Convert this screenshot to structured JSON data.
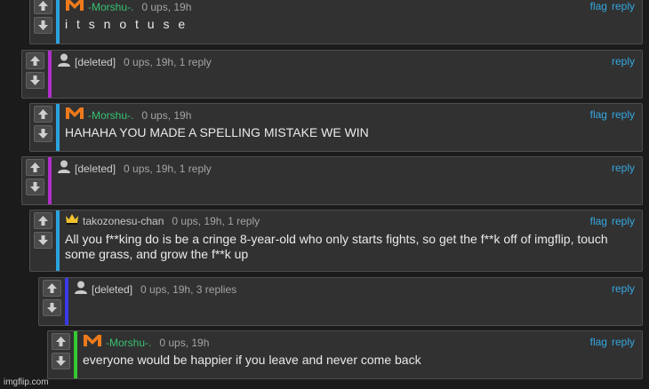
{
  "comments": [
    {
      "user": "-Morshu-.",
      "meta": "0 ups, 19h",
      "flag": "flag",
      "reply": "reply",
      "text": "i t s n o t u s e"
    },
    {
      "user": "[deleted]",
      "meta": "0 ups, 19h, 1 reply",
      "reply": "reply",
      "text": ""
    },
    {
      "user": "-Morshu-.",
      "meta": "0 ups, 19h",
      "flag": "flag",
      "reply": "reply",
      "text": "HAHAHA YOU MADE A SPELLING MISTAKE WE WIN"
    },
    {
      "user": "[deleted]",
      "meta": "0 ups, 19h, 1 reply",
      "reply": "reply",
      "text": ""
    },
    {
      "user": "takozonesu-chan",
      "meta": "0 ups, 19h, 1 reply",
      "flag": "flag",
      "reply": "reply",
      "text": "All you f**king do is be a cringe 8-year-old who only starts fights, so get the f**k off of imgflip, touch some grass, and grow the f**k up"
    },
    {
      "user": "[deleted]",
      "meta": "0 ups, 19h, 3 replies",
      "reply": "reply",
      "text": ""
    },
    {
      "user": "-Morshu-.",
      "meta": "0 ups, 19h",
      "flag": "flag",
      "reply": "reply",
      "text": "everyone would be happier if you leave and never come back"
    }
  ],
  "colors": {
    "panel": "#313131",
    "bar_cyan": "#2aa4de",
    "bar_magenta": "#b12fc9",
    "bar_blue": "#3a3ae6",
    "bar_green": "#34c930",
    "link": "#35a7e0",
    "username_green": "#38c172"
  },
  "watermark": "imgflip.com"
}
